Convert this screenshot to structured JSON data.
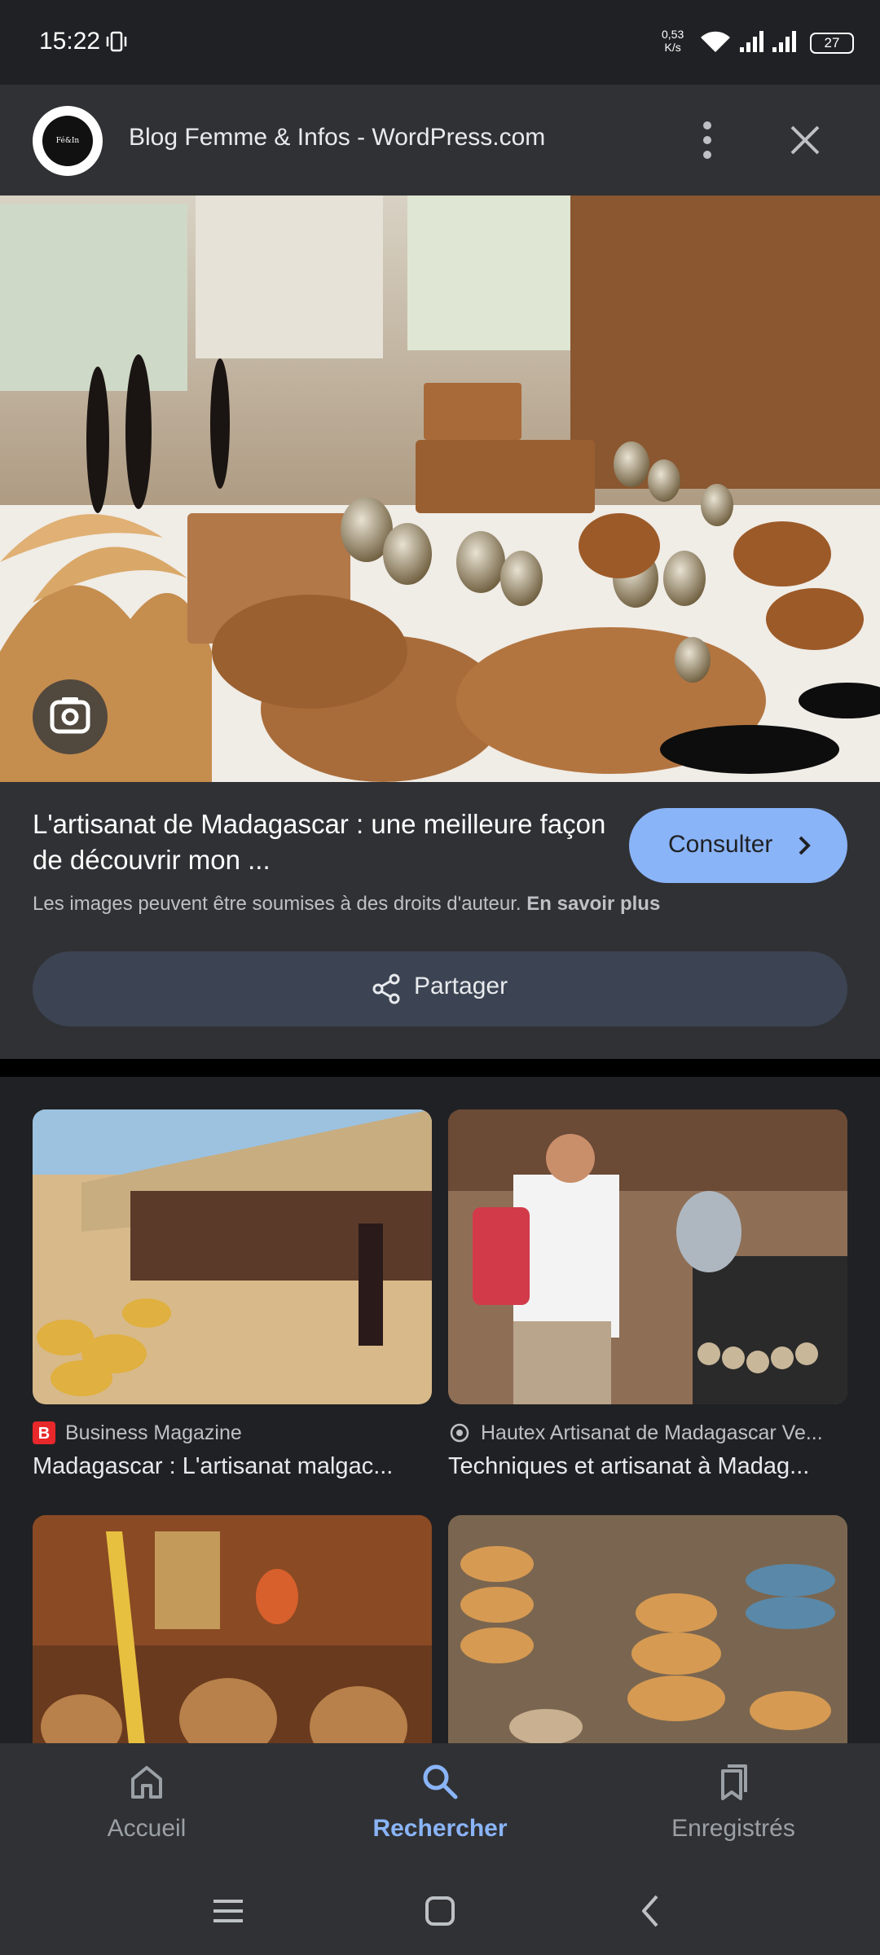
{
  "status_bar": {
    "time": "15:22",
    "net_speed_value": "0,53",
    "net_speed_unit": "K/s",
    "battery": "27"
  },
  "top_bar": {
    "site_title": "Blog Femme & Infos - WordPress.com",
    "logo_text": "Fé&In"
  },
  "result": {
    "headline": "L'artisanat de Madagascar : une meilleure façon de découvrir mon ...",
    "consult_label": "Consulter",
    "copyright_text": "Les images peuvent être soumises à des droits d'auteur.",
    "learn_more": "En savoir plus",
    "share_label": "Partager"
  },
  "related": [
    {
      "source": "Business Magazine",
      "title": "Madagascar : L'artisanat malgac...",
      "source_icon": "b-icon"
    },
    {
      "source": "Hautex Artisanat de Madagascar Ve...",
      "title": "Techniques et artisanat à Madag...",
      "source_icon": "globe-icon"
    },
    {
      "source": "",
      "title": "",
      "source_icon": ""
    },
    {
      "source": "",
      "title": "",
      "source_icon": ""
    }
  ],
  "bottom_nav": {
    "items": [
      {
        "label": "Accueil",
        "icon": "home-icon"
      },
      {
        "label": "Rechercher",
        "icon": "search-icon",
        "active": true
      },
      {
        "label": "Enregistrés",
        "icon": "bookmarks-icon"
      }
    ]
  },
  "colors": {
    "accent": "#8ab4f8",
    "background": "#202124",
    "surface": "#303134",
    "share_button": "#3c4453"
  }
}
